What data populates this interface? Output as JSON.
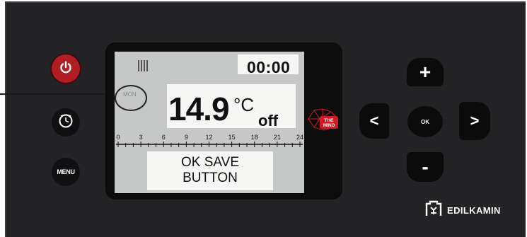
{
  "panel": {
    "menu_button_label": "MENU",
    "ok_button_label": "OK",
    "up_button_label": "+",
    "down_button_label": "-",
    "left_button_label": "<",
    "right_button_label": ">"
  },
  "display": {
    "time": "00:00",
    "day": "MON",
    "temperature": "14.9",
    "unit": "°C",
    "mode": "off",
    "hour_scale": [
      "0",
      "3",
      "6",
      "9",
      "12",
      "15",
      "18",
      "21",
      "24"
    ],
    "message_line1": "OK SAVE",
    "message_line2": "BUTTON"
  },
  "logo": {
    "line1": "THE",
    "line2": "MIND"
  },
  "brand": {
    "name": "EDILKAMIN"
  },
  "colors": {
    "power_button": "#b01d22",
    "panel_background": "#232325",
    "lcd_background": "#c6c8c7",
    "logo_red": "#d11a24"
  },
  "icons": [
    "power-icon",
    "clock-icon",
    "flame-bars-icon",
    "the-mind-logo-icon",
    "edilkamin-logo-icon"
  ]
}
